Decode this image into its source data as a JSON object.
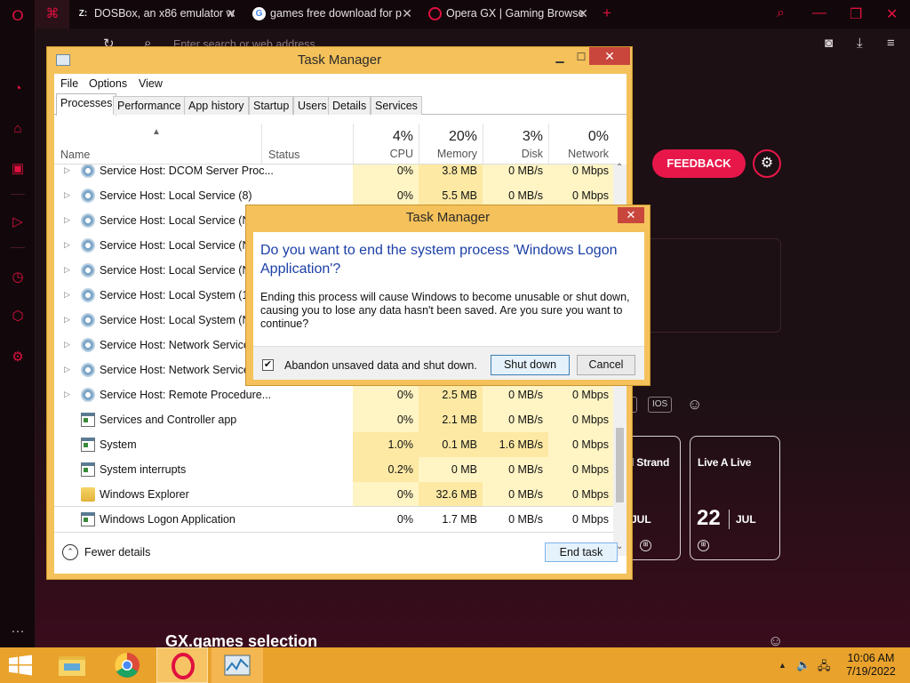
{
  "browser": {
    "tabs": [
      {
        "title": "DOSBox, an x86 emulator w",
        "icon": "z-icon"
      },
      {
        "title": "games free download for p",
        "icon": "google-icon"
      },
      {
        "title": "Opera GX | Gaming Browse",
        "icon": "opera-icon"
      }
    ],
    "address_placeholder": "Enter search or web address",
    "feedback_label": "FEEDBACK",
    "platform_chip": "IOS",
    "cards": [
      {
        "title": "l Strand",
        "month": "JUL"
      },
      {
        "title": "Live A Live",
        "day": "22",
        "month": "JUL"
      }
    ],
    "section_title": "GX.games selection",
    "accent_color": "#e8174a"
  },
  "taskmgr": {
    "title": "Task Manager",
    "menu": [
      "File",
      "Options",
      "View"
    ],
    "tabs": [
      "Processes",
      "Performance",
      "App history",
      "Startup",
      "Users",
      "Details",
      "Services"
    ],
    "active_tab": "Processes",
    "columns": {
      "name": "Name",
      "status": "Status",
      "cpu": {
        "pct": "4%",
        "label": "CPU"
      },
      "memory": {
        "pct": "20%",
        "label": "Memory"
      },
      "disk": {
        "pct": "3%",
        "label": "Disk"
      },
      "network": {
        "pct": "0%",
        "label": "Network"
      }
    },
    "rows": [
      {
        "name": "Service Host: DCOM Server Proc...",
        "cpu": "0%",
        "mem": "3.8 MB",
        "disk": "0 MB/s",
        "net": "0 Mbps",
        "icon": "gear"
      },
      {
        "name": "Service Host: Local Service (8)",
        "cpu": "0%",
        "mem": "5.5 MB",
        "disk": "0 MB/s",
        "net": "0 Mbps",
        "icon": "gear"
      },
      {
        "name": "Service Host: Local Service (Net",
        "cpu": "",
        "mem": "",
        "disk": "",
        "net": "",
        "icon": "gear"
      },
      {
        "name": "Service Host: Local Service (No",
        "cpu": "",
        "mem": "",
        "disk": "",
        "net": "",
        "icon": "gear"
      },
      {
        "name": "Service Host: Local Service (No",
        "cpu": "",
        "mem": "",
        "disk": "",
        "net": "",
        "icon": "gear"
      },
      {
        "name": "Service Host: Local System (14)",
        "cpu": "",
        "mem": "",
        "disk": "",
        "net": "",
        "icon": "gear"
      },
      {
        "name": "Service Host: Local System (Net",
        "cpu": "",
        "mem": "",
        "disk": "",
        "net": "",
        "icon": "gear"
      },
      {
        "name": "Service Host: Network Service (",
        "cpu": "",
        "mem": "",
        "disk": "",
        "net": "",
        "icon": "gear"
      },
      {
        "name": "Service Host: Network Service (",
        "cpu": "",
        "mem": "",
        "disk": "",
        "net": "",
        "icon": "gear"
      },
      {
        "name": "Service Host: Remote Procedure...",
        "cpu": "0%",
        "mem": "2.5 MB",
        "disk": "0 MB/s",
        "net": "0 Mbps",
        "icon": "gear"
      },
      {
        "name": "Services and Controller app",
        "cpu": "0%",
        "mem": "2.1 MB",
        "disk": "0 MB/s",
        "net": "0 Mbps",
        "icon": "win"
      },
      {
        "name": "System",
        "cpu": "1.0%",
        "mem": "0.1 MB",
        "disk": "1.6 MB/s",
        "net": "0 Mbps",
        "icon": "win"
      },
      {
        "name": "System interrupts",
        "cpu": "0.2%",
        "mem": "0 MB",
        "disk": "0 MB/s",
        "net": "0 Mbps",
        "icon": "win"
      },
      {
        "name": "Windows Explorer",
        "cpu": "0%",
        "mem": "32.6 MB",
        "disk": "0 MB/s",
        "net": "0 Mbps",
        "icon": "folder"
      },
      {
        "name": "Windows Logon Application",
        "cpu": "0%",
        "mem": "1.7 MB",
        "disk": "0 MB/s",
        "net": "0 Mbps",
        "icon": "win"
      }
    ],
    "fewer_details": "Fewer details",
    "end_task": "End task"
  },
  "dialog": {
    "title": "Task Manager",
    "question": "Do you want to end the system process 'Windows Logon Application'?",
    "message": "Ending this process will cause Windows to become unusable or shut down, causing you to lose any data hasn't been saved. Are you sure you want to continue?",
    "checkbox_label": "Abandon unsaved data and shut down.",
    "checkbox_checked": true,
    "shutdown_label": "Shut down",
    "cancel_label": "Cancel"
  },
  "taskbar": {
    "time": "10:06 AM",
    "date": "7/19/2022",
    "pins": [
      "file-explorer-icon",
      "chrome-icon",
      "opera-icon",
      "task-manager-icon"
    ]
  }
}
